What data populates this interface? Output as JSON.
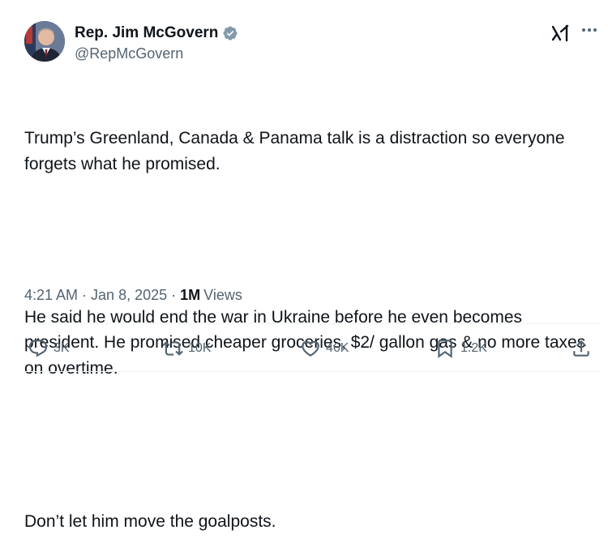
{
  "author": {
    "display_name": "Rep. Jim McGovern",
    "handle": "@RepMcGovern"
  },
  "tweet": {
    "paragraphs": [
      "Trump’s Greenland, Canada & Panama talk is a distraction so everyone forgets what he promised.",
      "He said he would end the war in Ukraine before he even becomes president. He promised cheaper groceries, $2/ gallon gas & no more taxes on overtime.",
      "Don’t let him move the goalposts."
    ]
  },
  "meta": {
    "time": "4:21 AM",
    "separator": "·",
    "date": "Jan 8, 2025",
    "views_count": "1M",
    "views_label": "Views"
  },
  "actions": {
    "replies": "3K",
    "reposts": "10K",
    "likes": "46K",
    "bookmarks": "1.2K"
  },
  "colors": {
    "text": "#0f1419",
    "secondary": "#536471",
    "verified": "#829aab",
    "divider": "#eff3f4"
  },
  "icons": [
    "verified-badge-icon",
    "grok-icon",
    "more-icon",
    "reply-icon",
    "repost-icon",
    "like-icon",
    "bookmark-icon",
    "share-icon"
  ]
}
